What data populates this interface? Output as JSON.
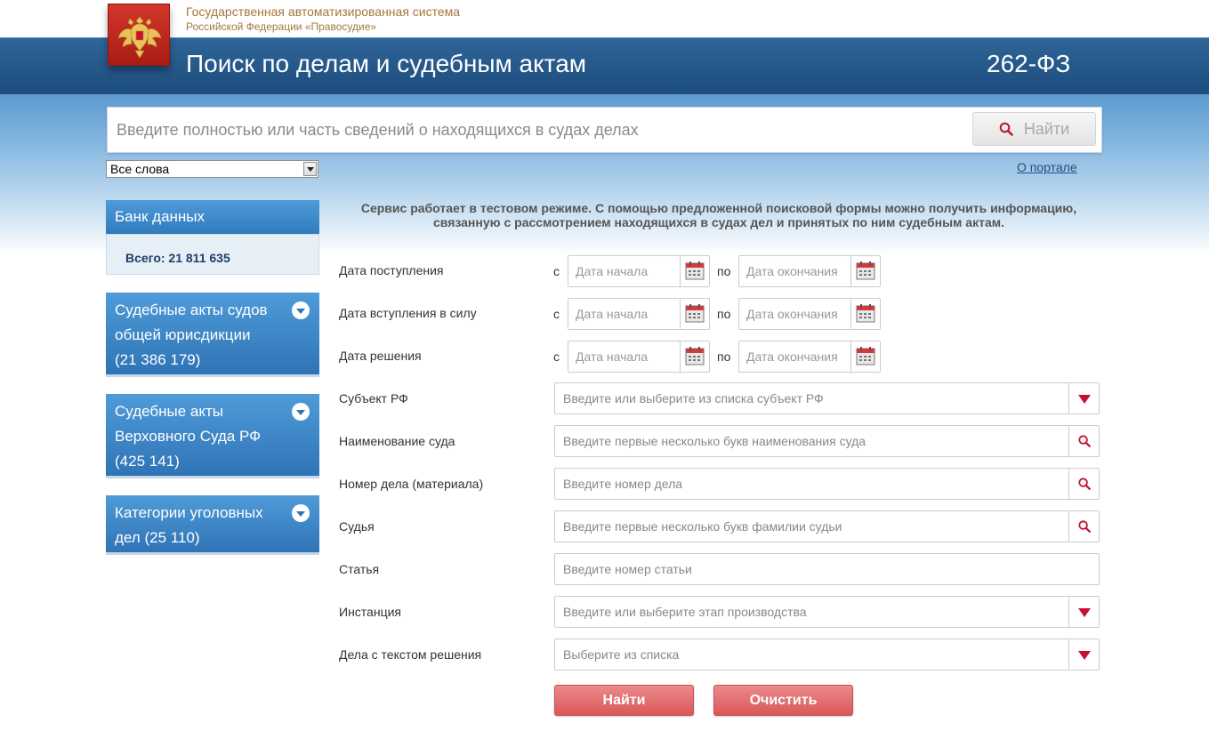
{
  "header": {
    "system_line1": "Государственная автоматизированная система",
    "system_line2": "Российской Федерации «Правосудие»",
    "title": "Поиск по делам и судебным актам",
    "law": "262-ФЗ",
    "emblem_icon": "coat-of-arms-icon"
  },
  "search": {
    "placeholder": "Введите полностью или часть сведений о находящихся в судах делах",
    "button_label": "Найти",
    "button_icon": "search-icon",
    "mode_selected": "Все слова",
    "about_link": "О портале"
  },
  "sidebar": {
    "bank_title": "Банк данных",
    "bank_total": "Всего: 21 811 635",
    "cards": [
      {
        "lines": [
          "Судебные акты судов",
          "общей юрисдикции",
          "(21 386 179)"
        ]
      },
      {
        "lines": [
          "Судебные акты",
          "Верховного Суда РФ",
          "(425 141)"
        ]
      },
      {
        "lines": [
          "Категории уголовных",
          "дел (25 110)"
        ]
      }
    ]
  },
  "notice": {
    "line1": "Сервис работает в тестовом режиме. С помощью предложенной поисковой формы можно получить информацию,",
    "line2": "связанную с рассмотрением находящихся в судах дел и принятых по ним судебным актам."
  },
  "form": {
    "from_prefix": "с",
    "to_prefix": "по",
    "start_placeholder": "Дата начала",
    "end_placeholder": "Дата окончания",
    "date_rows": [
      {
        "label": "Дата поступления"
      },
      {
        "label": "Дата вступления в силу"
      },
      {
        "label": "Дата решения"
      }
    ],
    "fields": [
      {
        "label": "Субъект РФ",
        "placeholder": "Введите или выберите из списка субъект РФ",
        "button": "dropdown-arrow-icon"
      },
      {
        "label": "Наименование суда",
        "placeholder": "Введите первые несколько букв наименования суда",
        "button": "search-icon"
      },
      {
        "label": "Номер дела (материала)",
        "placeholder": "Введите номер дела",
        "button": "search-icon"
      },
      {
        "label": "Судья",
        "placeholder": "Введите первые несколько букв фамилии судьи",
        "button": "search-icon"
      },
      {
        "label": "Статья",
        "placeholder": "Введите номер статьи",
        "button": ""
      },
      {
        "label": "Инстанция",
        "placeholder": "Введите или выберите этап производства",
        "button": "dropdown-arrow-icon"
      },
      {
        "label": "Дела с текстом решения",
        "placeholder": "Выберите из списка",
        "button": "dropdown-arrow-icon"
      }
    ],
    "submit_label": "Найти",
    "clear_label": "Очистить"
  },
  "colors": {
    "header_blue": "#1d4c7d",
    "sidebar_blue": "#2f7bbf",
    "accent_red": "#c8102e",
    "button_red": "#d9575a",
    "system_text_gold": "#a0793c"
  }
}
